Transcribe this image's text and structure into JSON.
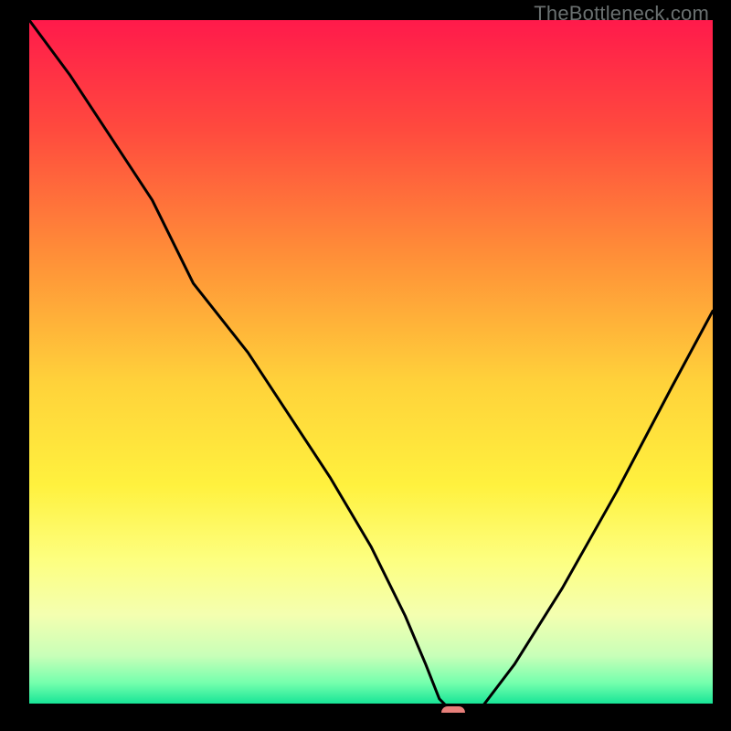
{
  "watermark": "TheBottleneck.com",
  "colors": {
    "black": "#000000",
    "curve": "#000000",
    "marker": "#e77f7a",
    "watermark": "#6a7070",
    "gradient_stops": [
      {
        "pct": 0,
        "color": "#ff1a4b"
      },
      {
        "pct": 16,
        "color": "#ff4a3e"
      },
      {
        "pct": 34,
        "color": "#ff8d38"
      },
      {
        "pct": 53,
        "color": "#ffd23a"
      },
      {
        "pct": 68,
        "color": "#fff13e"
      },
      {
        "pct": 79,
        "color": "#fdff80"
      },
      {
        "pct": 87,
        "color": "#f4ffb0"
      },
      {
        "pct": 93,
        "color": "#c8ffb8"
      },
      {
        "pct": 97,
        "color": "#74ffad"
      },
      {
        "pct": 100,
        "color": "#18e597"
      }
    ]
  },
  "chart_data": {
    "type": "line",
    "title": "",
    "xlabel": "",
    "ylabel": "",
    "xlim": [
      0,
      100
    ],
    "ylim": [
      0,
      100
    ],
    "grid": false,
    "note": "Axes are normalized (0–100 of plot width/height). Higher y = higher bottleneck score (red), y≈0 at green. Curve minimum near x≈62, marker at (62,0).",
    "series": [
      {
        "name": "bottleneck-curve",
        "x": [
          0,
          6,
          12,
          18,
          24,
          28,
          32,
          38,
          44,
          50,
          55,
          58,
          60,
          62,
          64,
          66,
          71,
          78,
          86,
          94,
          100
        ],
        "y": [
          100,
          92,
          83,
          74,
          62,
          57,
          52,
          43,
          34,
          24,
          14,
          7,
          2,
          0,
          0,
          0.5,
          7,
          18,
          32,
          47,
          58
        ]
      }
    ],
    "marker": {
      "x": 62,
      "y": 0
    }
  }
}
